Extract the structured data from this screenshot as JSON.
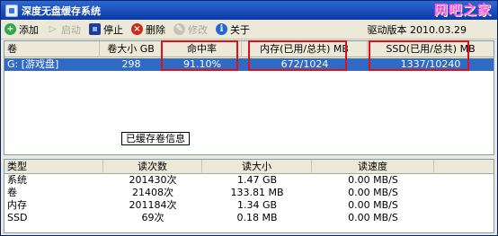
{
  "window": {
    "title": "深度无盘缓存系统",
    "logo_text": "网吧之家",
    "version": "驱动版本 2010.03.29"
  },
  "toolbar": {
    "items": [
      {
        "label": "添加",
        "icon": "plus-icon",
        "enabled": true
      },
      {
        "label": "启动",
        "icon": "play-icon",
        "enabled": false
      },
      {
        "label": "停止",
        "icon": "stop-icon",
        "enabled": true
      },
      {
        "label": "删除",
        "icon": "delete-icon",
        "enabled": true
      },
      {
        "label": "修改",
        "icon": "edit-icon",
        "enabled": false
      },
      {
        "label": "关于",
        "icon": "info-icon",
        "enabled": true
      }
    ]
  },
  "volume_table": {
    "columns": [
      "卷",
      "卷大小 GB",
      "命中率",
      "内存(已用/总共) MB",
      "SSD(已用/总共) MB"
    ],
    "rows": [
      {
        "volume": "G: [游戏盘]",
        "size": "298",
        "hit_rate": "91.10%",
        "memory": "672/1024",
        "ssd": "1337/10240"
      }
    ]
  },
  "info_label": "已缓存卷信息",
  "stats_table": {
    "columns": [
      "类型",
      "读次数",
      "读大小",
      "读速度"
    ],
    "rows": [
      {
        "type": "系统",
        "reads": "201430次",
        "size": "1.47 GB",
        "speed": "0.00 MB/S"
      },
      {
        "type": "卷",
        "reads": "21408次",
        "size": "133.81 MB",
        "speed": "0.00 MB/S"
      },
      {
        "type": "内存",
        "reads": "201184次",
        "size": "1.34 GB",
        "speed": "0.00 MB/S"
      },
      {
        "type": "SSD",
        "reads": "69次",
        "size": "0.18 MB",
        "speed": "0.00 MB/S"
      }
    ]
  },
  "colors": {
    "titlebar": "#1f54c2",
    "selection": "#316ac5",
    "highlight_box": "#e0101a"
  }
}
